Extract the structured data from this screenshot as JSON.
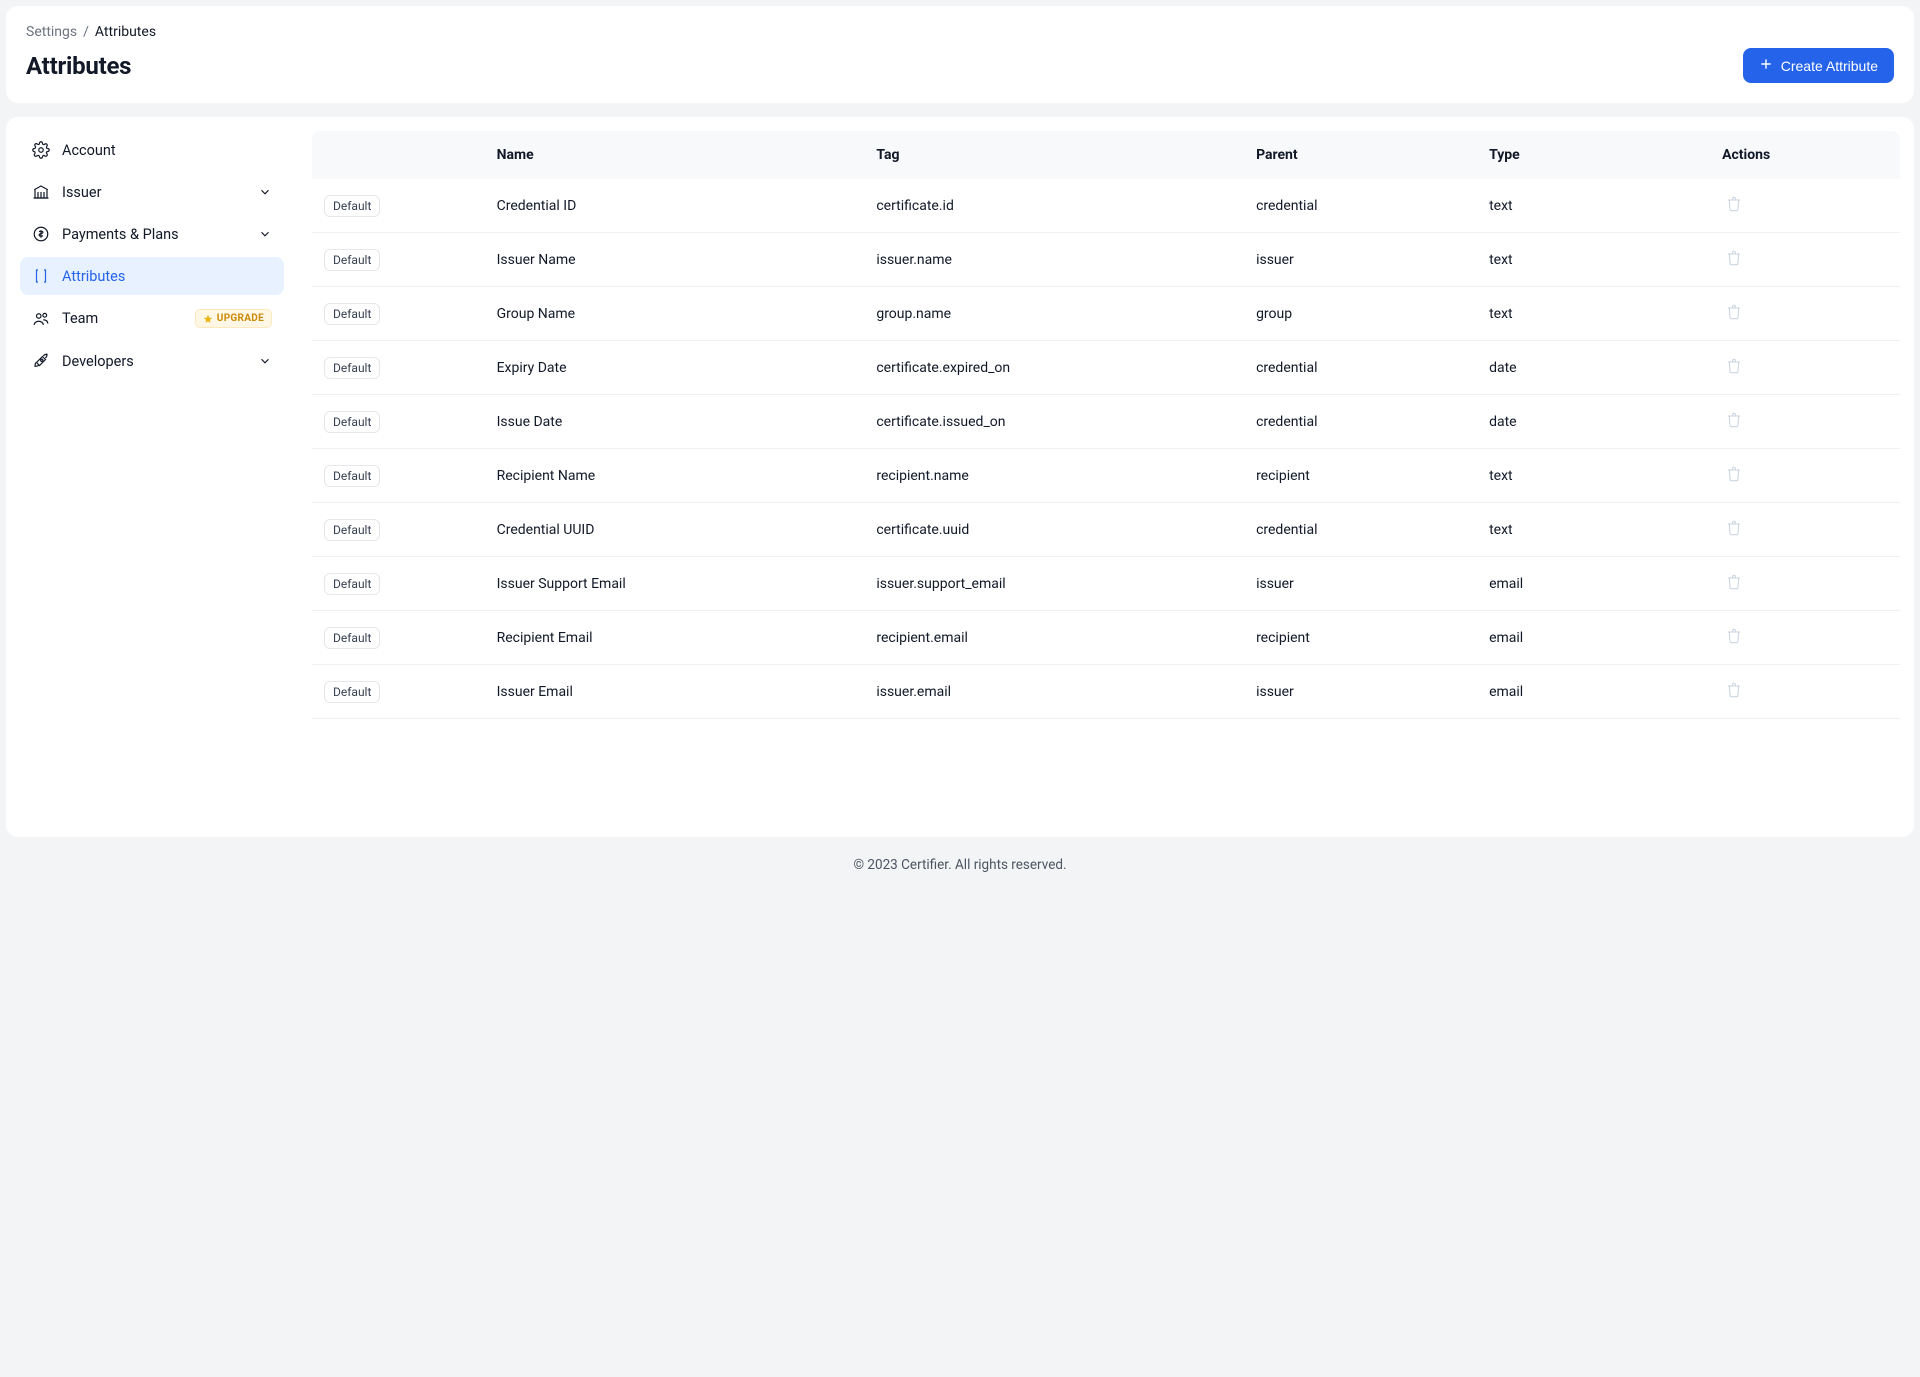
{
  "breadcrumb": {
    "parent": "Settings",
    "sep": "/",
    "current": "Attributes"
  },
  "page": {
    "title": "Attributes"
  },
  "buttons": {
    "create": "Create Attribute"
  },
  "sidebar": {
    "items": [
      {
        "label": "Account",
        "expandable": false
      },
      {
        "label": "Issuer",
        "expandable": true
      },
      {
        "label": "Payments & Plans",
        "expandable": true
      },
      {
        "label": "Attributes",
        "expandable": false,
        "active": true
      },
      {
        "label": "Team",
        "expandable": false,
        "badge": "UPGRADE"
      },
      {
        "label": "Developers",
        "expandable": true
      }
    ]
  },
  "table": {
    "headers": {
      "name": "Name",
      "tag": "Tag",
      "parent": "Parent",
      "type": "Type",
      "actions": "Actions"
    },
    "default_badge": "Default",
    "rows": [
      {
        "name": "Credential ID",
        "tag": "certificate.id",
        "parent": "credential",
        "type": "text"
      },
      {
        "name": "Issuer Name",
        "tag": "issuer.name",
        "parent": "issuer",
        "type": "text"
      },
      {
        "name": "Group Name",
        "tag": "group.name",
        "parent": "group",
        "type": "text"
      },
      {
        "name": "Expiry Date",
        "tag": "certificate.expired_on",
        "parent": "credential",
        "type": "date"
      },
      {
        "name": "Issue Date",
        "tag": "certificate.issued_on",
        "parent": "credential",
        "type": "date"
      },
      {
        "name": "Recipient Name",
        "tag": "recipient.name",
        "parent": "recipient",
        "type": "text"
      },
      {
        "name": "Credential UUID",
        "tag": "certificate.uuid",
        "parent": "credential",
        "type": "text"
      },
      {
        "name": "Issuer Support Email",
        "tag": "issuer.support_email",
        "parent": "issuer",
        "type": "email"
      },
      {
        "name": "Recipient Email",
        "tag": "recipient.email",
        "parent": "recipient",
        "type": "email"
      },
      {
        "name": "Issuer Email",
        "tag": "issuer.email",
        "parent": "issuer",
        "type": "email"
      }
    ]
  },
  "footer": {
    "text": "© 2023 Certifier. All rights reserved."
  }
}
